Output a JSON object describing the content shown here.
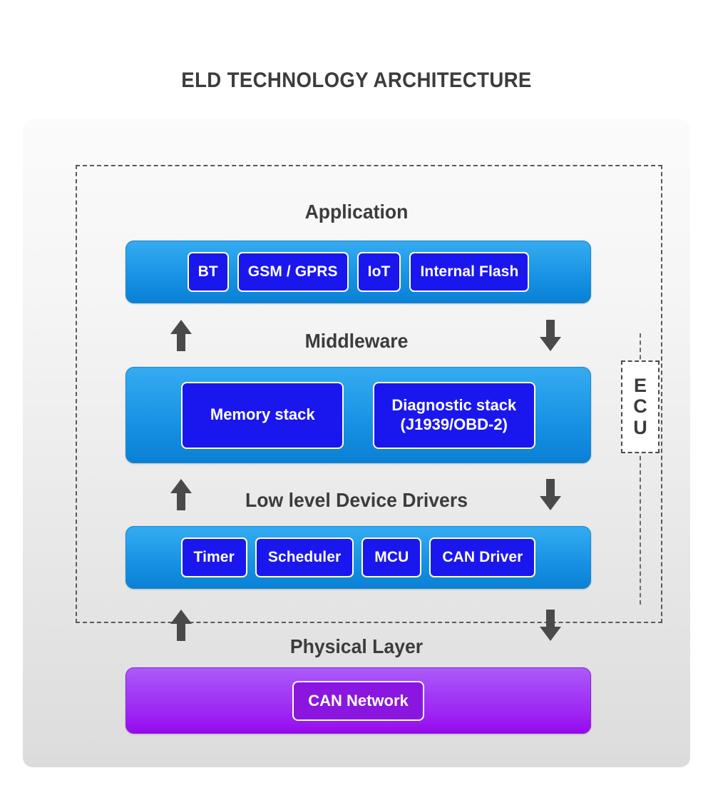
{
  "title": "ELD TECHNOLOGY ARCHITECTURE",
  "ecu": {
    "label": "ECU",
    "letters": [
      "E",
      "C",
      "U"
    ]
  },
  "layers": {
    "application": {
      "label": "Application",
      "chips": [
        {
          "label": "BT"
        },
        {
          "label": "GSM / GPRS"
        },
        {
          "label": "IoT"
        },
        {
          "label": "Internal Flash"
        }
      ]
    },
    "middleware": {
      "label": "Middleware",
      "chips": [
        {
          "label": "Memory stack"
        },
        {
          "label": "Diagnostic stack\n(J1939/OBD-2)",
          "line1": "Diagnostic stack",
          "line2": "(J1939/OBD-2)"
        }
      ]
    },
    "lowlevel": {
      "label": "Low level Device Drivers",
      "chips": [
        {
          "label": "Timer"
        },
        {
          "label": "Scheduler"
        },
        {
          "label": "MCU"
        },
        {
          "label": "CAN Driver"
        }
      ]
    },
    "physical": {
      "label": "Physical Layer",
      "chips": [
        {
          "label": "CAN Network"
        }
      ]
    }
  },
  "colors": {
    "title_text": "#3c3c3c",
    "blue_bar_top": "#35abf0",
    "blue_bar_bottom": "#0a80d4",
    "chip_blue": "#1a17ee",
    "purple_bar_top": "#ac5cf8",
    "purple_bar_bottom": "#9608ee",
    "chip_purple": "#8b16e0",
    "arrow": "#4a4a4a",
    "dashed_border": "#5a5a5a",
    "card_top": "#fbfbfb",
    "card_bottom": "#dcdcdc"
  }
}
